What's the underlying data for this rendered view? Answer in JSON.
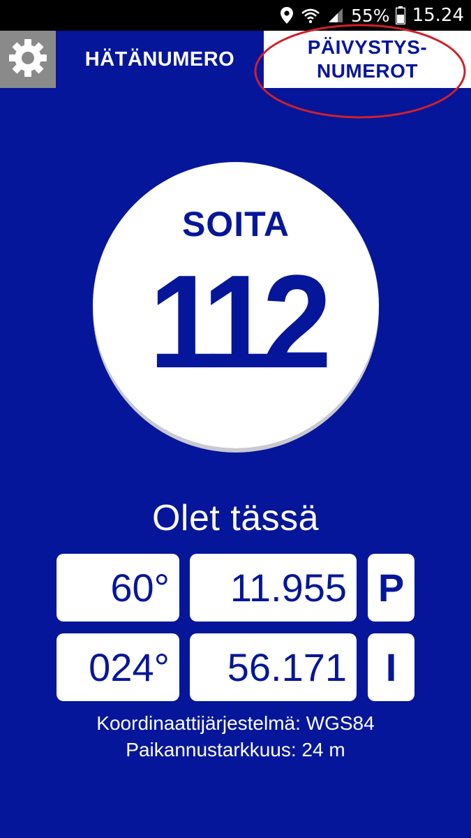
{
  "status_bar": {
    "icons": [
      "location-pin-icon",
      "wifi-icon",
      "cell-signal-icon"
    ],
    "battery_percent": "55%",
    "battery_icon": "battery-icon",
    "time": "15.24"
  },
  "tabs": {
    "settings_icon": "gear-icon",
    "emergency_label": "HÄTÄNUMERO",
    "duty_label": "PÄIVYSTYS-\nNUMEROT"
  },
  "call": {
    "label": "SOITA",
    "number": "112"
  },
  "location": {
    "title": "Olet tässä",
    "latitude": {
      "degrees": "60°",
      "minutes": "11.955",
      "direction": "P"
    },
    "longitude": {
      "degrees": "024°",
      "minutes": "56.171",
      "direction": "I"
    },
    "coordinate_system": "Koordinaattijärjestelmä: WGS84",
    "accuracy": "Paikannustarkkuus: 24 m"
  },
  "colors": {
    "background": "#05169a",
    "accent_white": "#ffffff",
    "settings_gray": "#8a8a8a",
    "annotation_red": "#d0202a"
  }
}
